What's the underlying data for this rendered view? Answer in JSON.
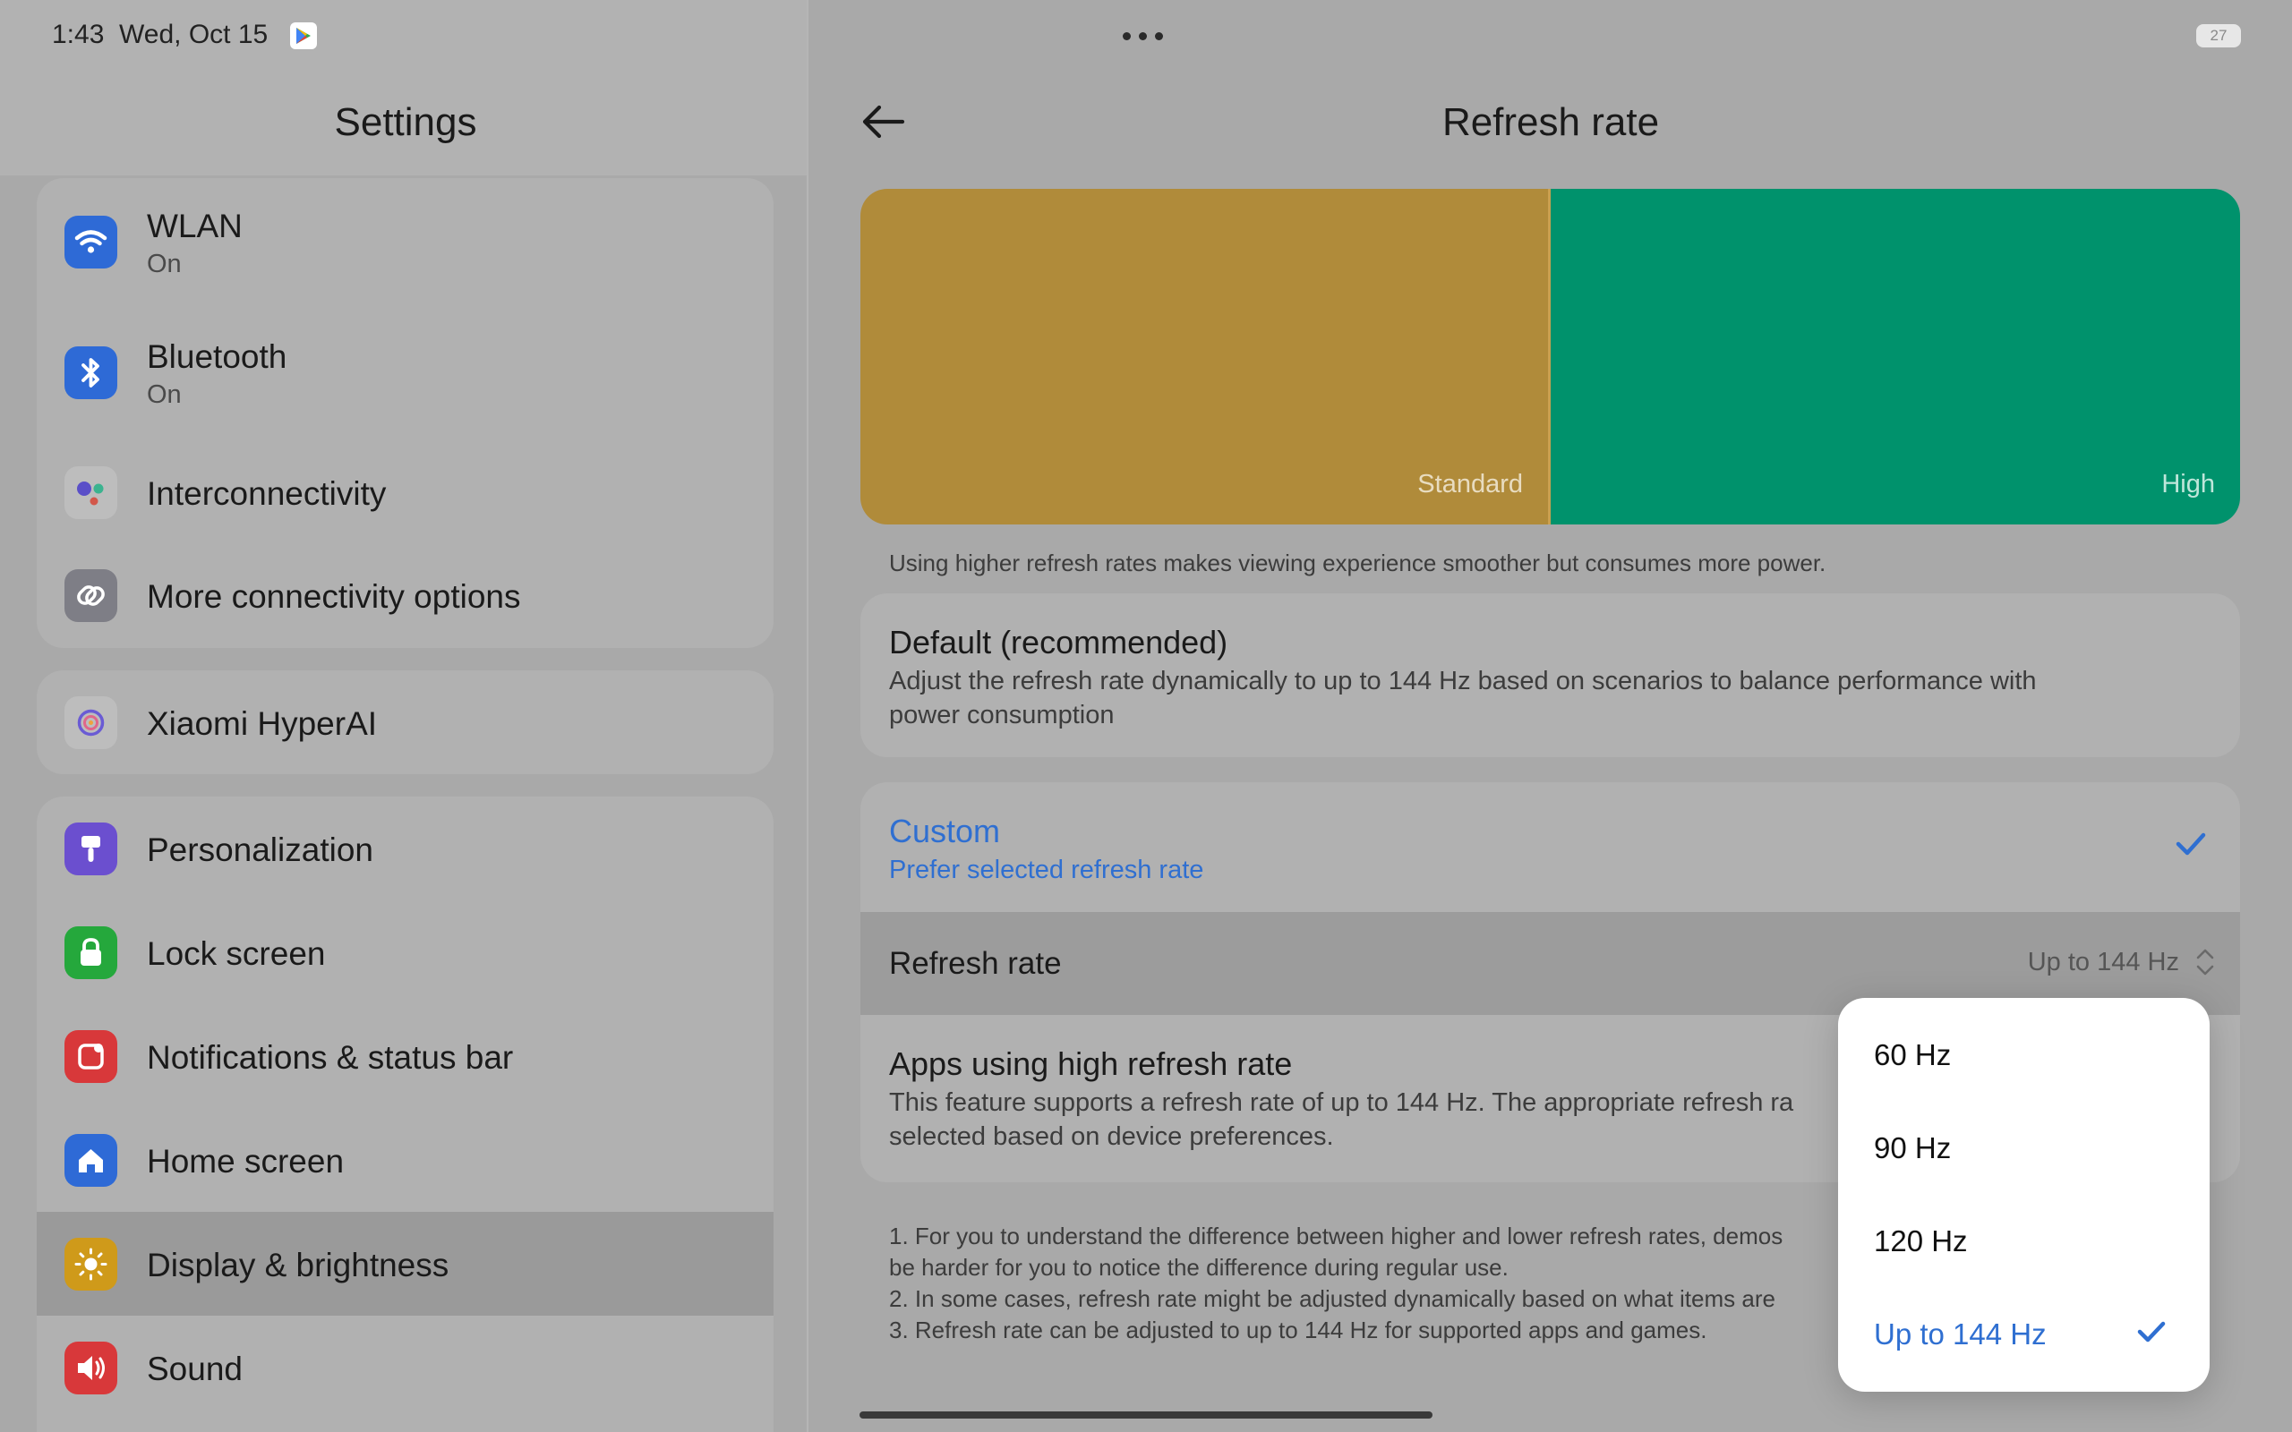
{
  "status_bar": {
    "time": "1:43",
    "date": "Wed, Oct 15",
    "battery": "27"
  },
  "left": {
    "title": "Settings",
    "groups": [
      {
        "items": [
          {
            "label": "WLAN",
            "sublabel": "On",
            "icon": "wifi-icon"
          },
          {
            "label": "Bluetooth",
            "sublabel": "On",
            "icon": "bluetooth-icon"
          },
          {
            "label": "Interconnectivity",
            "icon": "interconnectivity-icon"
          },
          {
            "label": "More connectivity options",
            "icon": "link-icon"
          }
        ]
      },
      {
        "items": [
          {
            "label": "Xiaomi HyperAI",
            "icon": "hyperai-icon"
          }
        ]
      },
      {
        "items": [
          {
            "label": "Personalization",
            "icon": "brush-icon"
          },
          {
            "label": "Lock screen",
            "icon": "lock-icon"
          },
          {
            "label": "Notifications & status bar",
            "icon": "notification-icon"
          },
          {
            "label": "Home screen",
            "icon": "home-icon"
          },
          {
            "label": "Display & brightness",
            "icon": "sun-icon",
            "selected": true
          },
          {
            "label": "Sound",
            "icon": "speaker-icon"
          }
        ]
      }
    ]
  },
  "right": {
    "title": "Refresh rate",
    "preview": {
      "standard_label": "Standard",
      "high_label": "High",
      "standard_color": "#b08b3a",
      "high_color": "#00926c"
    },
    "caption": "Using higher refresh rates makes viewing experience smoother but consumes more power.",
    "default_option": {
      "title": "Default (recommended)",
      "desc_line1": "Adjust the refresh rate dynamically to up to 144 Hz based on scenarios to balance performance with",
      "desc_line2": "power consumption"
    },
    "custom_option": {
      "title": "Custom",
      "desc": "Prefer selected refresh rate",
      "selected": true,
      "refresh_rate_label": "Refresh rate",
      "refresh_rate_value": "Up to 144 Hz"
    },
    "apps_option": {
      "title": "Apps using high refresh rate",
      "desc_line1": "This feature supports a refresh rate of up to 144 Hz. The appropriate refresh ra",
      "desc_line2": "selected based on device preferences."
    },
    "footnotes": [
      "1. For you to understand the difference between higher and lower refresh rates, demos",
      "be harder for you to notice the difference during regular use.",
      "2. In some cases, refresh rate might be adjusted dynamically based on what items are",
      "3. Refresh rate can be adjusted to up to 144 Hz for supported apps and games."
    ]
  },
  "dropdown": {
    "options": [
      "60 Hz",
      "90 Hz",
      "120 Hz",
      "Up to 144 Hz"
    ],
    "selected": "Up to 144 Hz"
  },
  "colors": {
    "accent": "#2f6fd1"
  }
}
